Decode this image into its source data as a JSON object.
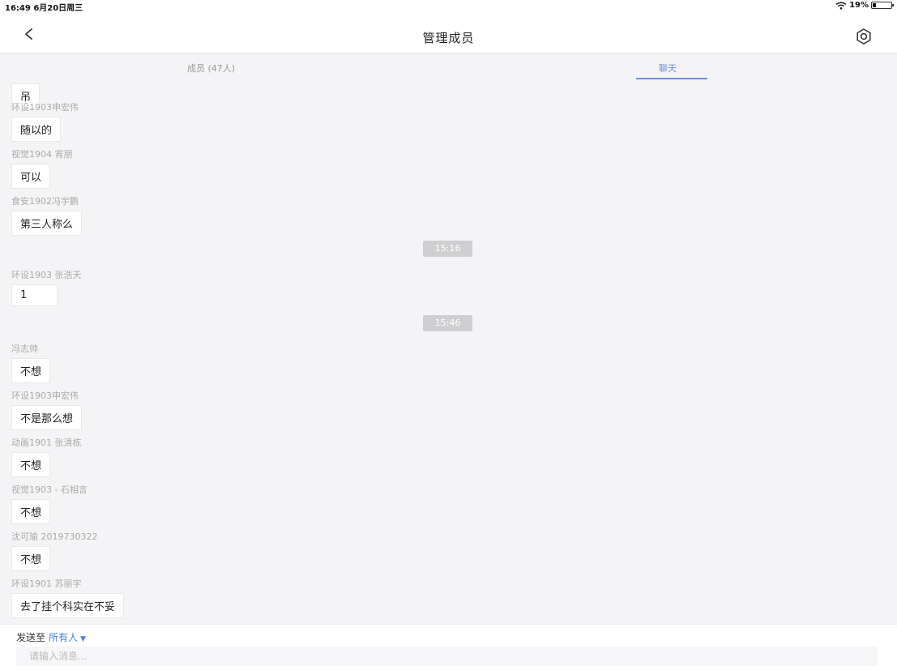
{
  "status_bar": {
    "time": "16:49  6月20日周三",
    "battery": "19%",
    "battery_level": 0.19
  },
  "nav": {
    "title": "管理成员"
  },
  "tabs": {
    "members": "成员 (47人)",
    "chat": "聊天"
  },
  "messages": [
    {
      "sender": "",
      "text": "吊"
    },
    {
      "sender": "环设1903申宏伟",
      "text": "随以的"
    },
    {
      "sender": "视觉1904 宵朋",
      "text": "可以"
    },
    {
      "sender": "食安1902冯宇鹏",
      "text": "第三人称么"
    },
    {
      "sender": "环设1903 张浩天",
      "text": "1"
    },
    {
      "sender": "冯志帅",
      "text": "不想"
    },
    {
      "sender": "环设1903申宏伟",
      "text": "不是那么想"
    },
    {
      "sender": "动画1901 张清栋",
      "text": "不想"
    },
    {
      "sender": "视觉1903 - 石相言",
      "text": "不想"
    },
    {
      "sender": "沈可瑜 2019730322",
      "text": "不想"
    },
    {
      "sender": "环设1901 苏丽宇",
      "text": "去了挂个科实在不妥"
    }
  ],
  "timestamps": [
    "15:16",
    "15:46"
  ],
  "composer": {
    "send_to_label": "发送至",
    "send_target": "所有人",
    "placeholder": "请输入消息..."
  }
}
